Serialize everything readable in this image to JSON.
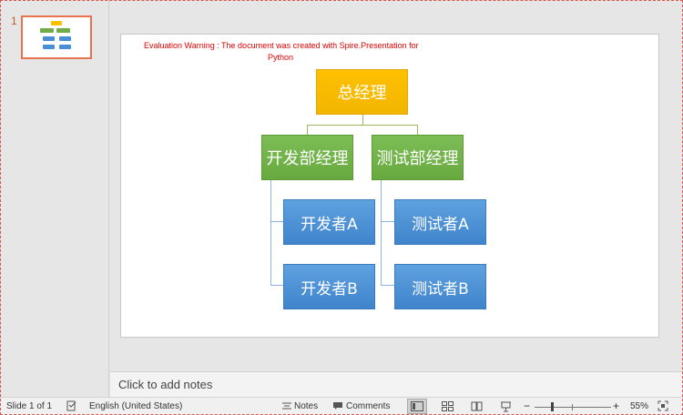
{
  "thumbnail": {
    "number": "1"
  },
  "slide": {
    "warning_line1": "Evaluation Warning : The document was created with Spire.Presentation for",
    "warning_line2": "Python",
    "org": {
      "root": "总经理",
      "managers": [
        "开发部经理",
        "测试部经理"
      ],
      "dev_members": [
        "开发者A",
        "开发者B"
      ],
      "test_members": [
        "测试者A",
        "测试者B"
      ]
    },
    "colors": {
      "root": "#ffc000",
      "manager": "#70ad47",
      "member": "#4a8fd6",
      "warning": "#e00000"
    }
  },
  "notes": {
    "placeholder": "Click to add notes"
  },
  "status": {
    "slide_info": "Slide 1 of 1",
    "language": "English (United States)",
    "notes_label": "Notes",
    "comments_label": "Comments",
    "zoom_minus": "−",
    "zoom_plus": "+",
    "zoom": "55%",
    "zoom_level_percent": 55
  }
}
